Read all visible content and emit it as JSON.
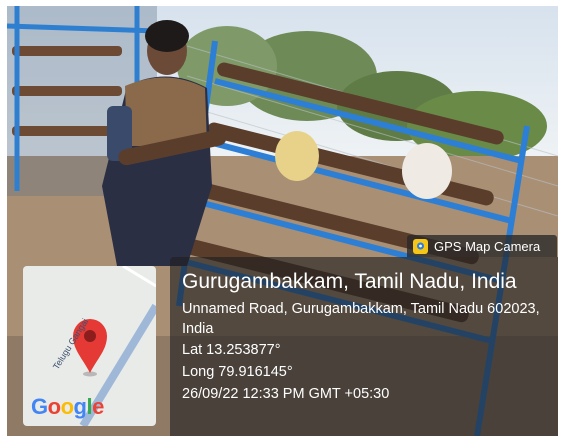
{
  "map": {
    "road_label": "Telugu Gangai",
    "logo_letters": [
      {
        "char": "G",
        "color": "#4285F4"
      },
      {
        "char": "o",
        "color": "#EA4335"
      },
      {
        "char": "o",
        "color": "#FBBC05"
      },
      {
        "char": "g",
        "color": "#4285F4"
      },
      {
        "char": "l",
        "color": "#34A853"
      },
      {
        "char": "e",
        "color": "#EA4335"
      }
    ],
    "pin_color": "#E53935"
  },
  "badge": {
    "label": "GPS Map Camera",
    "icon": "gps-map-camera-icon"
  },
  "location": {
    "title": "Gurugambakkam, Tamil Nadu, India",
    "address": "Unnamed Road, Gurugambakkam, Tamil Nadu 602023, India",
    "lat": "Lat 13.253877°",
    "long": "Long 79.916145°",
    "timestamp": "26/09/22 12:33 PM GMT +05:30"
  }
}
